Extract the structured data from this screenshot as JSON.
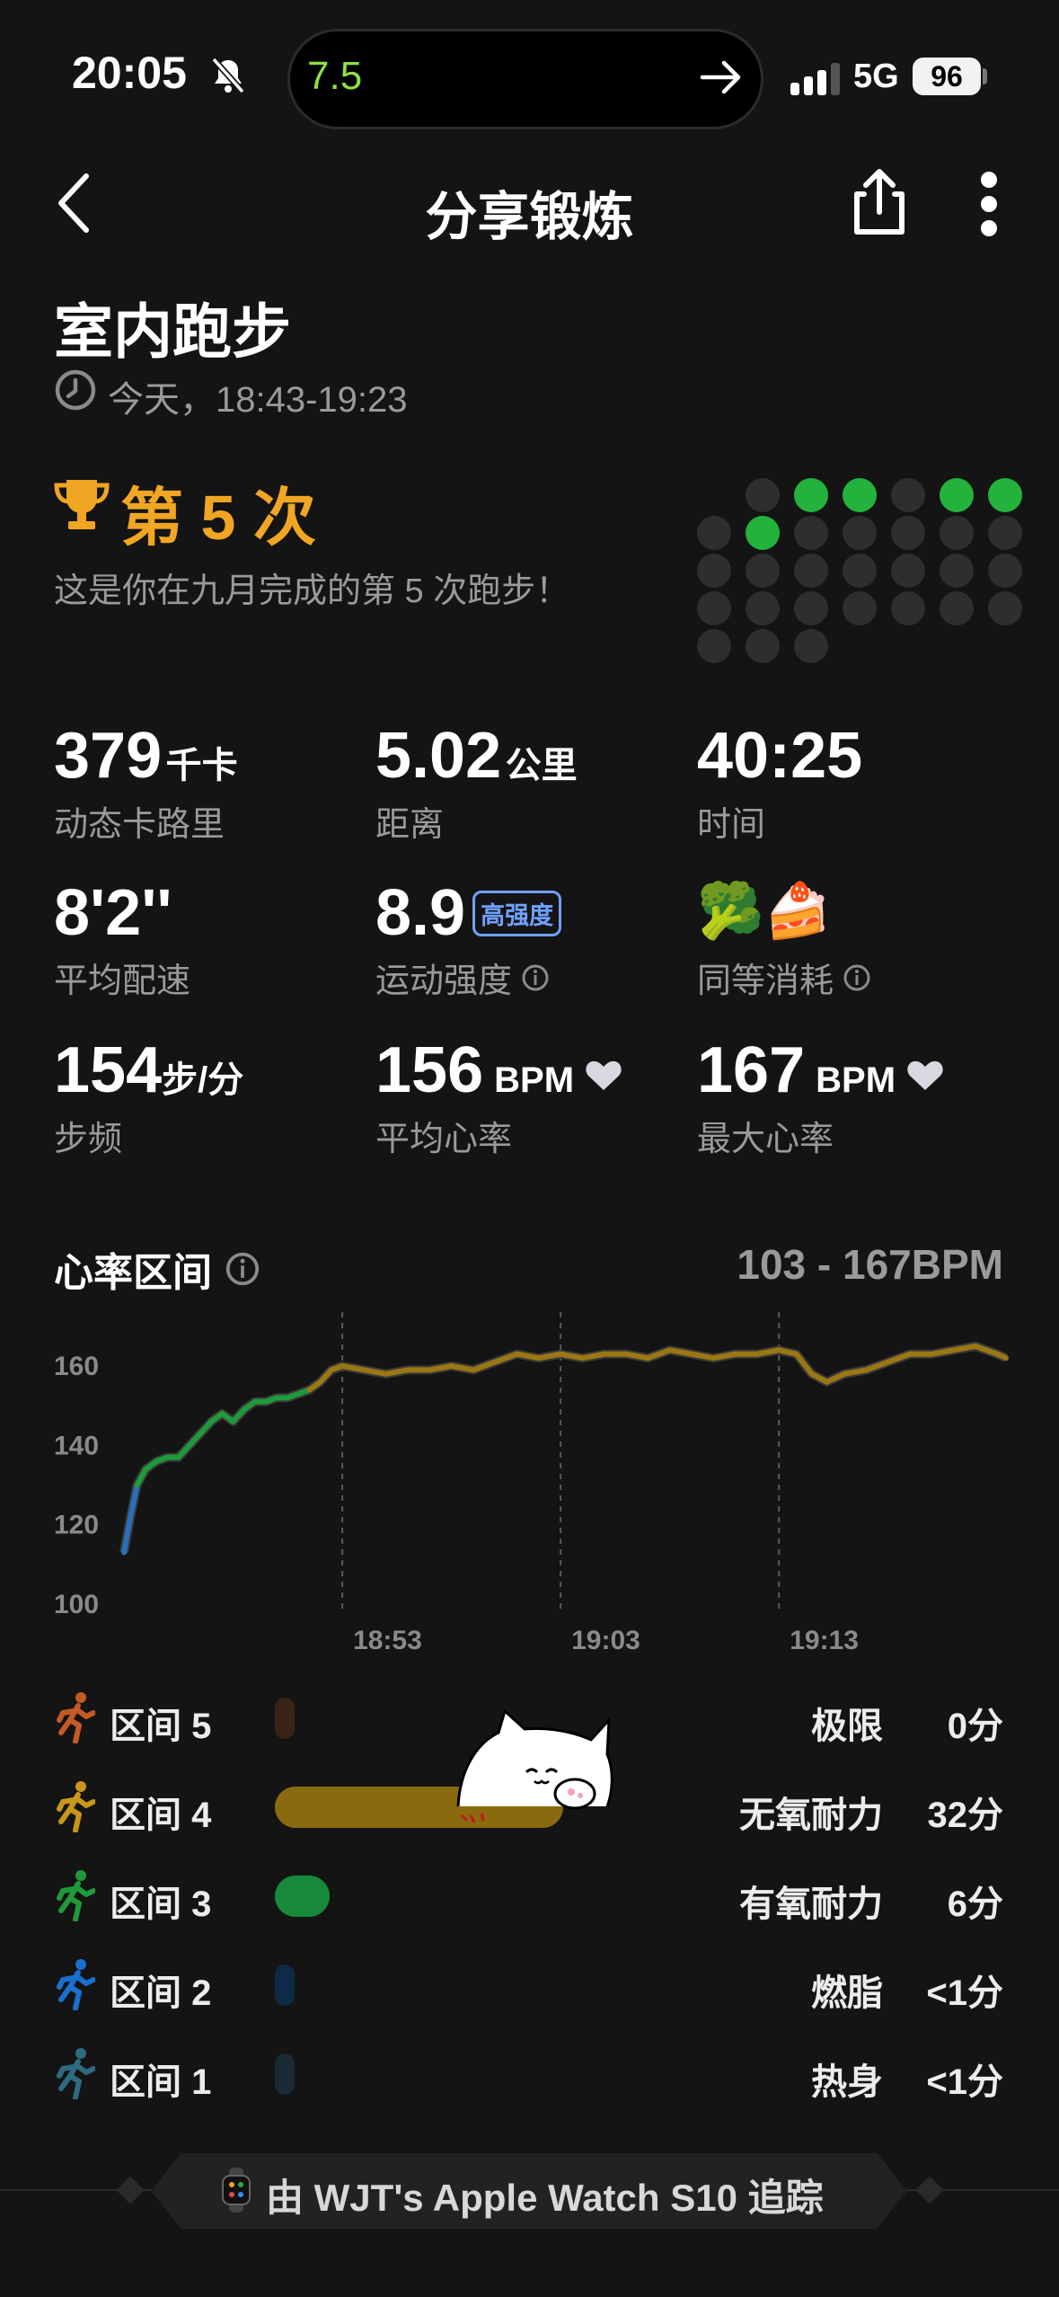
{
  "status": {
    "time": "20:05",
    "island_value": "7.5",
    "network": "5G",
    "battery": "96"
  },
  "nav": {
    "title": "分享锻炼"
  },
  "workout": {
    "title": "室内跑步",
    "time_range": "今天，18:43-19:23"
  },
  "achievement": {
    "rank": "第 5 次",
    "description": "这是你在九月完成的第 5 次跑步！"
  },
  "calendar_dots": [
    [
      null,
      0,
      1,
      1,
      0,
      1,
      1
    ],
    [
      0,
      1,
      0,
      0,
      0,
      0,
      0
    ],
    [
      0,
      0,
      0,
      0,
      0,
      0,
      0
    ],
    [
      0,
      0,
      0,
      0,
      0,
      0,
      0
    ],
    [
      0,
      0,
      0,
      null,
      null,
      null,
      null
    ]
  ],
  "stats": {
    "calories": {
      "value": "379",
      "unit": "千卡",
      "label": "动态卡路里"
    },
    "distance": {
      "value": "5.02",
      "unit": "公里",
      "label": "距离"
    },
    "duration": {
      "value": "40:25",
      "label": "时间"
    },
    "pace": {
      "value": "8'2''",
      "label": "平均配速"
    },
    "intensity": {
      "value": "8.9",
      "badge": "高强度",
      "label": "运动强度"
    },
    "equivalent": {
      "emoji": "🥦🍰",
      "label": "同等消耗"
    },
    "cadence": {
      "value": "154",
      "unit": "步/分",
      "label": "步频"
    },
    "avg_hr": {
      "value": "156",
      "unit": "BPM",
      "label": "平均心率"
    },
    "max_hr": {
      "value": "167",
      "unit": "BPM",
      "label": "最大心率"
    }
  },
  "hr_section": {
    "title": "心率区间",
    "range": "103 - 167BPM"
  },
  "chart_data": {
    "type": "line",
    "y_ticks": [
      "160",
      "140",
      "120",
      "100"
    ],
    "x_ticks": [
      "18:53",
      "19:03",
      "19:13"
    ],
    "ylim": [
      100,
      167
    ],
    "x_minutes_range": [
      0,
      40.4
    ],
    "x_tick_minutes": [
      10,
      20,
      30
    ],
    "x": [
      0,
      0.3,
      0.6,
      1,
      1.5,
      2,
      2.5,
      3,
      3.5,
      4,
      4.5,
      5,
      5.5,
      6,
      6.5,
      7,
      7.5,
      8,
      8.5,
      9,
      9.5,
      10,
      11,
      12,
      13,
      14,
      15,
      16,
      17,
      18,
      19,
      20,
      21,
      22,
      23,
      24,
      25,
      26,
      27,
      28,
      29,
      30,
      30.8,
      31.5,
      32.2,
      33,
      34,
      35,
      36,
      37,
      38,
      39,
      40,
      40.4
    ],
    "y": [
      113,
      122,
      130,
      134,
      136,
      137,
      137,
      140,
      143,
      146,
      148,
      146,
      149,
      151,
      151,
      152,
      152,
      153,
      154,
      156,
      159,
      160,
      159,
      158,
      159,
      159,
      160,
      159,
      161,
      163,
      162,
      163,
      162,
      163,
      163,
      162,
      164,
      163,
      162,
      163,
      163,
      164,
      163,
      158,
      156,
      158,
      159,
      161,
      163,
      163,
      164,
      165,
      163,
      162
    ],
    "zone_colors": [
      "#2a6fb8",
      "#1f9a3a",
      "#9a7712"
    ],
    "zone_breaks": [
      127,
      154
    ]
  },
  "zones": [
    {
      "name": "区间 5",
      "desc": "极限",
      "time": "0分",
      "color": "#3a2418",
      "icon_color": "#c45a25",
      "fraction": 0
    },
    {
      "name": "区间 4",
      "desc": "无氧耐力",
      "time": "32分",
      "color": "#8a6a0e",
      "icon_color": "#c8961a",
      "fraction": 0.79
    },
    {
      "name": "区间 3",
      "desc": "有氧耐力",
      "time": "6分",
      "color": "#17893a",
      "icon_color": "#1f9a3a",
      "fraction": 0.15
    },
    {
      "name": "区间 2",
      "desc": "燃脂",
      "time": "<1分",
      "color": "#0e2a48",
      "icon_color": "#1a6fd0",
      "fraction": 0.02
    },
    {
      "name": "区间 1",
      "desc": "热身",
      "time": "<1分",
      "color": "#1a2a34",
      "icon_color": "#2e6b80",
      "fraction": 0.01
    }
  ],
  "footer": {
    "text": "由 WJT's Apple Watch S10 追踪"
  }
}
